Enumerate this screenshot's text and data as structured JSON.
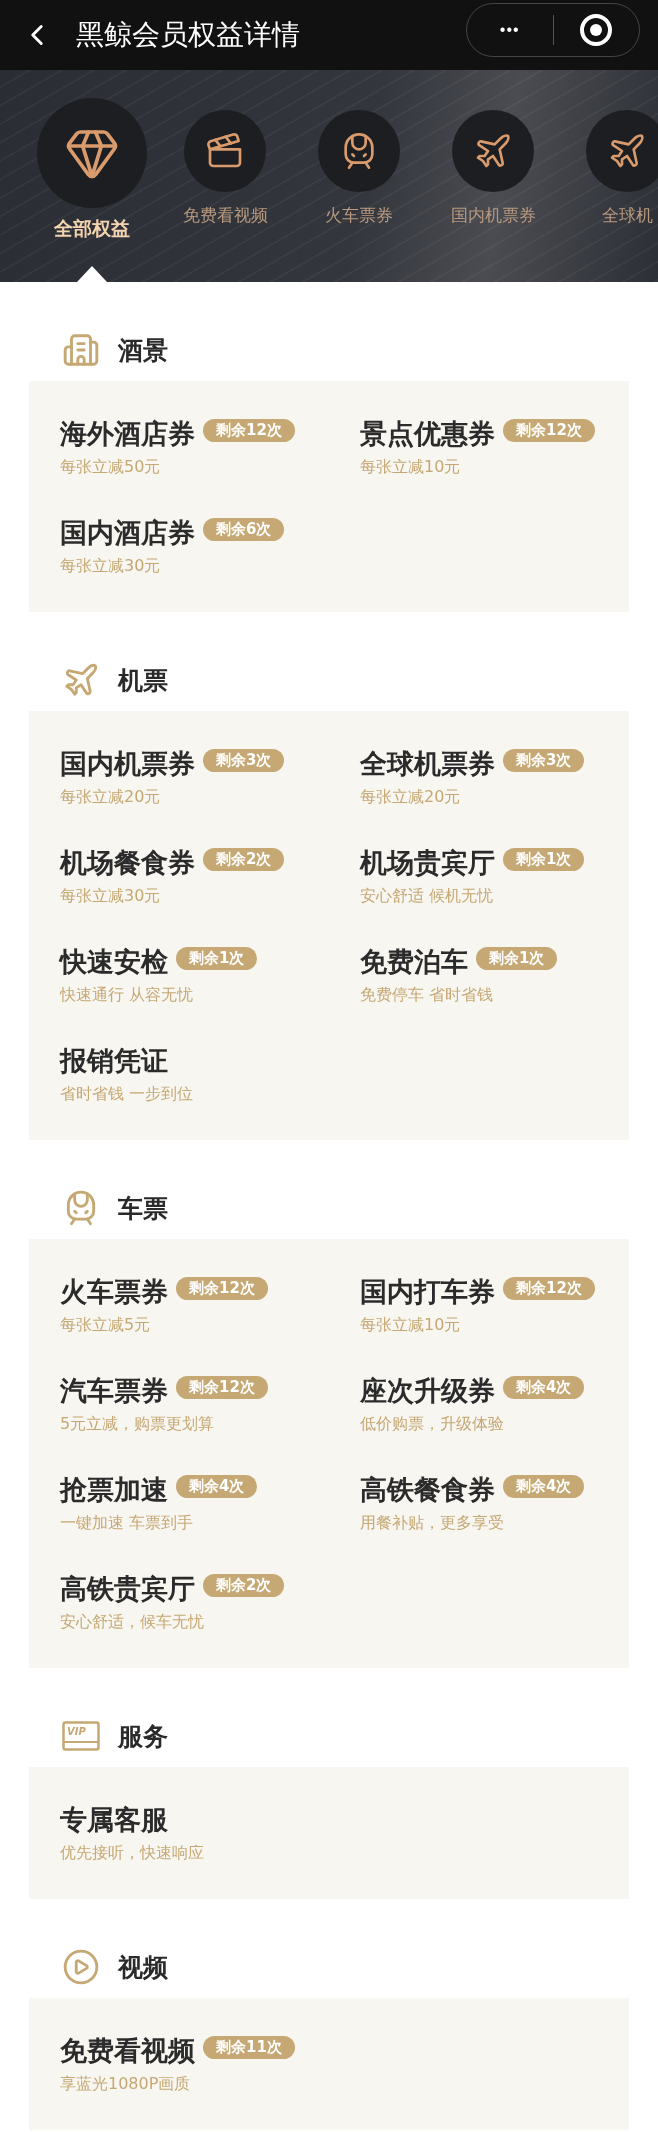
{
  "nav": {
    "title": "黑鲸会员权益详情",
    "menu_dots": "•••"
  },
  "tabs": [
    {
      "label": "全部权益",
      "kind": "diamond",
      "selected": true
    },
    {
      "label": "免费看视频",
      "kind": "video",
      "selected": false
    },
    {
      "label": "火车票券",
      "kind": "train",
      "selected": false
    },
    {
      "label": "国内机票券",
      "kind": "plane",
      "selected": false
    },
    {
      "label": "全球机",
      "kind": "plane",
      "selected": false
    }
  ],
  "sections": [
    {
      "title": "酒景",
      "kind": "building",
      "items": [
        {
          "name": "海外酒店券",
          "badge": "剩余12次",
          "desc": "每张立减50元"
        },
        {
          "name": "景点优惠券",
          "badge": "剩余12次",
          "desc": "每张立减10元"
        },
        {
          "name": "国内酒店券",
          "badge": "剩余6次",
          "desc": "每张立减30元"
        }
      ]
    },
    {
      "title": "机票",
      "kind": "plane",
      "items": [
        {
          "name": "国内机票券",
          "badge": "剩余3次",
          "desc": "每张立减20元"
        },
        {
          "name": "全球机票券",
          "badge": "剩余3次",
          "desc": "每张立减20元"
        },
        {
          "name": "机场餐食券",
          "badge": "剩余2次",
          "desc": "每张立减30元"
        },
        {
          "name": "机场贵宾厅",
          "badge": "剩余1次",
          "desc": "安心舒适 候机无忧"
        },
        {
          "name": "快速安检",
          "badge": "剩余1次",
          "desc": "快速通行 从容无忧"
        },
        {
          "name": "免费泊车",
          "badge": "剩余1次",
          "desc": "免费停车 省时省钱"
        },
        {
          "name": "报销凭证",
          "desc": "省时省钱 一步到位"
        }
      ]
    },
    {
      "title": "车票",
      "kind": "train",
      "items": [
        {
          "name": "火车票券",
          "badge": "剩余12次",
          "desc": "每张立减5元"
        },
        {
          "name": "国内打车券",
          "badge": "剩余12次",
          "desc": "每张立减10元"
        },
        {
          "name": "汽车票券",
          "badge": "剩余12次",
          "desc": "5元立减，购票更划算"
        },
        {
          "name": "座次升级券",
          "badge": "剩余4次",
          "desc": "低价购票，升级体验"
        },
        {
          "name": "抢票加速",
          "badge": "剩余4次",
          "desc": "一键加速 车票到手"
        },
        {
          "name": "高铁餐食券",
          "badge": "剩余4次",
          "desc": "用餐补贴，更多享受"
        },
        {
          "name": "高铁贵宾厅",
          "badge": "剩余2次",
          "desc": "安心舒适，候车无忧"
        }
      ]
    },
    {
      "title": "服务",
      "kind": "vip",
      "icon_text": "VIP",
      "items": [
        {
          "name": "专属客服",
          "desc": "优先接听，快速响应"
        }
      ]
    },
    {
      "title": "视频",
      "kind": "play",
      "items": [
        {
          "name": "免费看视频",
          "badge": "剩余11次",
          "desc": "享蓝光1080P画质"
        }
      ]
    }
  ]
}
